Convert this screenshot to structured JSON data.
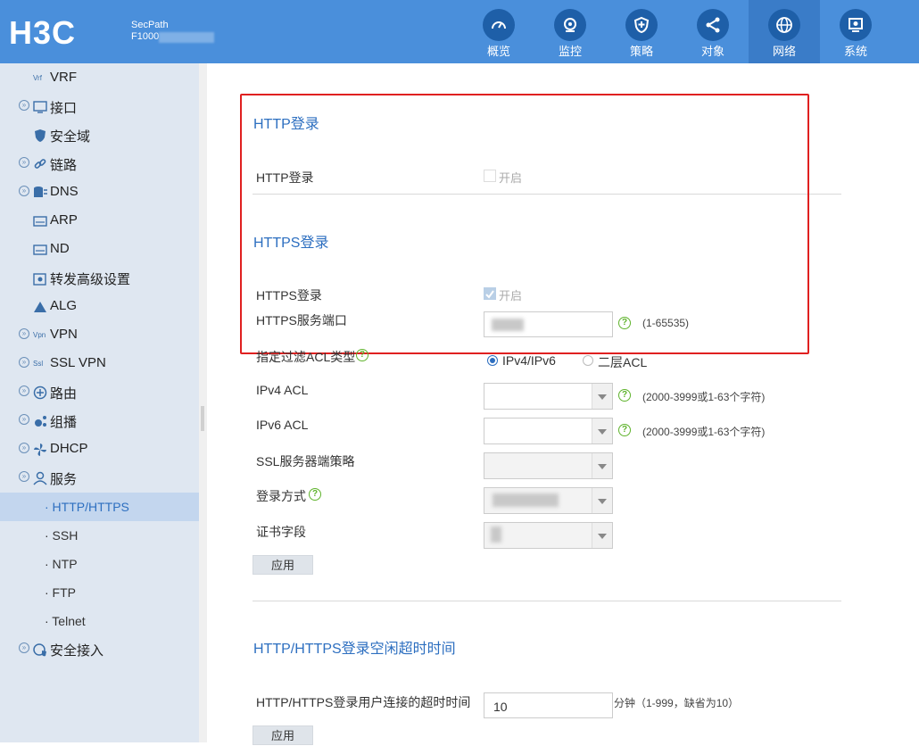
{
  "header": {
    "product_line1": "SecPath",
    "product_line2": "F1000",
    "nav": [
      {
        "label": "概览",
        "icon": "gauge-icon"
      },
      {
        "label": "监控",
        "icon": "camera-icon"
      },
      {
        "label": "策略",
        "icon": "shield-plus-icon"
      },
      {
        "label": "对象",
        "icon": "share-icon"
      },
      {
        "label": "网络",
        "icon": "globe-icon",
        "active": true
      },
      {
        "label": "系统",
        "icon": "monitor-gear-icon"
      }
    ]
  },
  "sidebar": {
    "items": [
      {
        "label": "VRF"
      },
      {
        "label": "接口"
      },
      {
        "label": "安全域"
      },
      {
        "label": "链路"
      },
      {
        "label": "DNS"
      },
      {
        "label": "ARP"
      },
      {
        "label": "ND"
      },
      {
        "label": "转发高级设置"
      },
      {
        "label": "ALG"
      },
      {
        "label": "VPN"
      },
      {
        "label": "SSL VPN"
      },
      {
        "label": "路由"
      },
      {
        "label": "组播"
      },
      {
        "label": "DHCP"
      },
      {
        "label": "服务"
      }
    ],
    "subitems": [
      {
        "label": "· HTTP/HTTPS",
        "active": true
      },
      {
        "label": "· SSH"
      },
      {
        "label": "· NTP"
      },
      {
        "label": "· FTP"
      },
      {
        "label": "· Telnet"
      }
    ],
    "last": {
      "label": "安全接入"
    }
  },
  "main": {
    "http_section": "HTTP登录",
    "http_login_label": "HTTP登录",
    "http_enable": "开启",
    "https_section": "HTTPS登录",
    "https_login_label": "HTTPS登录",
    "https_enable": "开启",
    "https_port_label": "HTTPS服务端口",
    "https_port_hint": "(1-65535)",
    "acl_type_label": "指定过滤ACL类型",
    "acl_type_opt1": "IPv4/IPv6",
    "acl_type_opt2": "二层ACL",
    "ipv4_acl_label": "IPv4 ACL",
    "ipv4_acl_hint": "(2000-3999或1-63个字符)",
    "ipv6_acl_label": "IPv6 ACL",
    "ipv6_acl_hint": "(2000-3999或1-63个字符)",
    "ssl_policy_label": "SSL服务器端策略",
    "login_mode_label": "登录方式",
    "cert_field_label": "证书字段",
    "apply_label": "应用",
    "idle_section": "HTTP/HTTPS登录空闲超时时间",
    "idle_label": "HTTP/HTTPS登录用户连接的超时时间",
    "idle_value": "10",
    "idle_hint": "分钟（1-999，缺省为10）",
    "apply2_label": "应用"
  },
  "colors": {
    "header": "#4a8fdb",
    "accent": "#2d6fc0",
    "sidebar": "#dfe7f1",
    "highlight_box": "#e02020"
  }
}
